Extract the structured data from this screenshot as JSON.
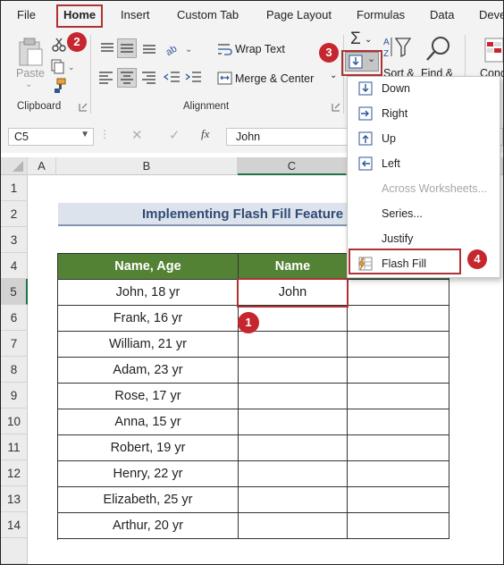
{
  "menu": {
    "tabs": [
      "File",
      "Home",
      "Insert",
      "Custom Tab",
      "Page Layout",
      "Formulas",
      "Data",
      "Deve"
    ],
    "active": "Home"
  },
  "ribbon": {
    "clipboard": {
      "paste_label": "Paste",
      "group_label": "Clipboard"
    },
    "alignment": {
      "wrap_text": "Wrap Text",
      "merge_center": "Merge & Center",
      "group_label": "Alignment"
    },
    "editing": {
      "sort_label": "Sort &",
      "find_label": "Find &",
      "cond_label": "Cond"
    }
  },
  "formula_bar": {
    "name_box": "C5",
    "fx": "fx",
    "value": "John"
  },
  "grid": {
    "columns": [
      "A",
      "B",
      "C"
    ],
    "rows": [
      "1",
      "2",
      "3",
      "4",
      "5",
      "6",
      "7",
      "8",
      "9",
      "10",
      "11",
      "12",
      "13",
      "14"
    ]
  },
  "sheet": {
    "title": "Implementing Flash Fill Feature",
    "header": [
      "Name, Age",
      "Name"
    ],
    "names": [
      "John, 18 yr",
      "Frank, 16 yr",
      "William, 21 yr",
      "Adam, 23 yr",
      "Rose, 17 yr",
      "Anna, 15 yr",
      "Robert, 19 yr",
      "Henry, 22 yr",
      "Elizabeth, 25 yr",
      "Arthur, 20 yr"
    ],
    "first_output": "John"
  },
  "fill_menu": {
    "items": [
      "Down",
      "Right",
      "Up",
      "Left",
      "Across Worksheets...",
      "Series...",
      "Justify",
      "Flash Fill"
    ]
  },
  "badges": [
    "1",
    "2",
    "3",
    "4"
  ],
  "colors": {
    "header_green": "#548235",
    "callout_red": "#b03232",
    "badge_red": "#c6262e",
    "title_blue": "#2f4b73"
  }
}
